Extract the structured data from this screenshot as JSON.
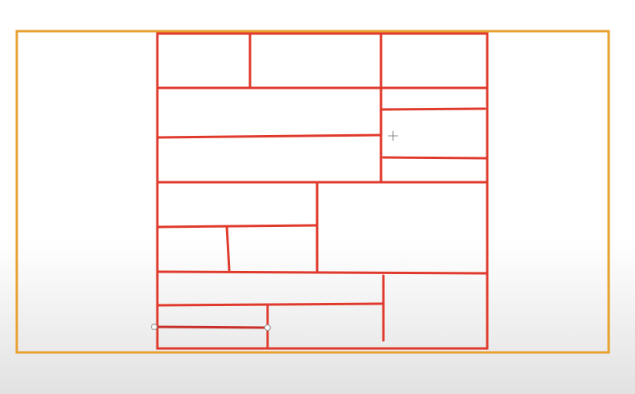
{
  "canvas": {
    "frame_color": "#e8a030",
    "line_color": "#e03a2c",
    "handle_color": "#9a9a9a",
    "cursor_icon": "move-crosshair-icon"
  }
}
